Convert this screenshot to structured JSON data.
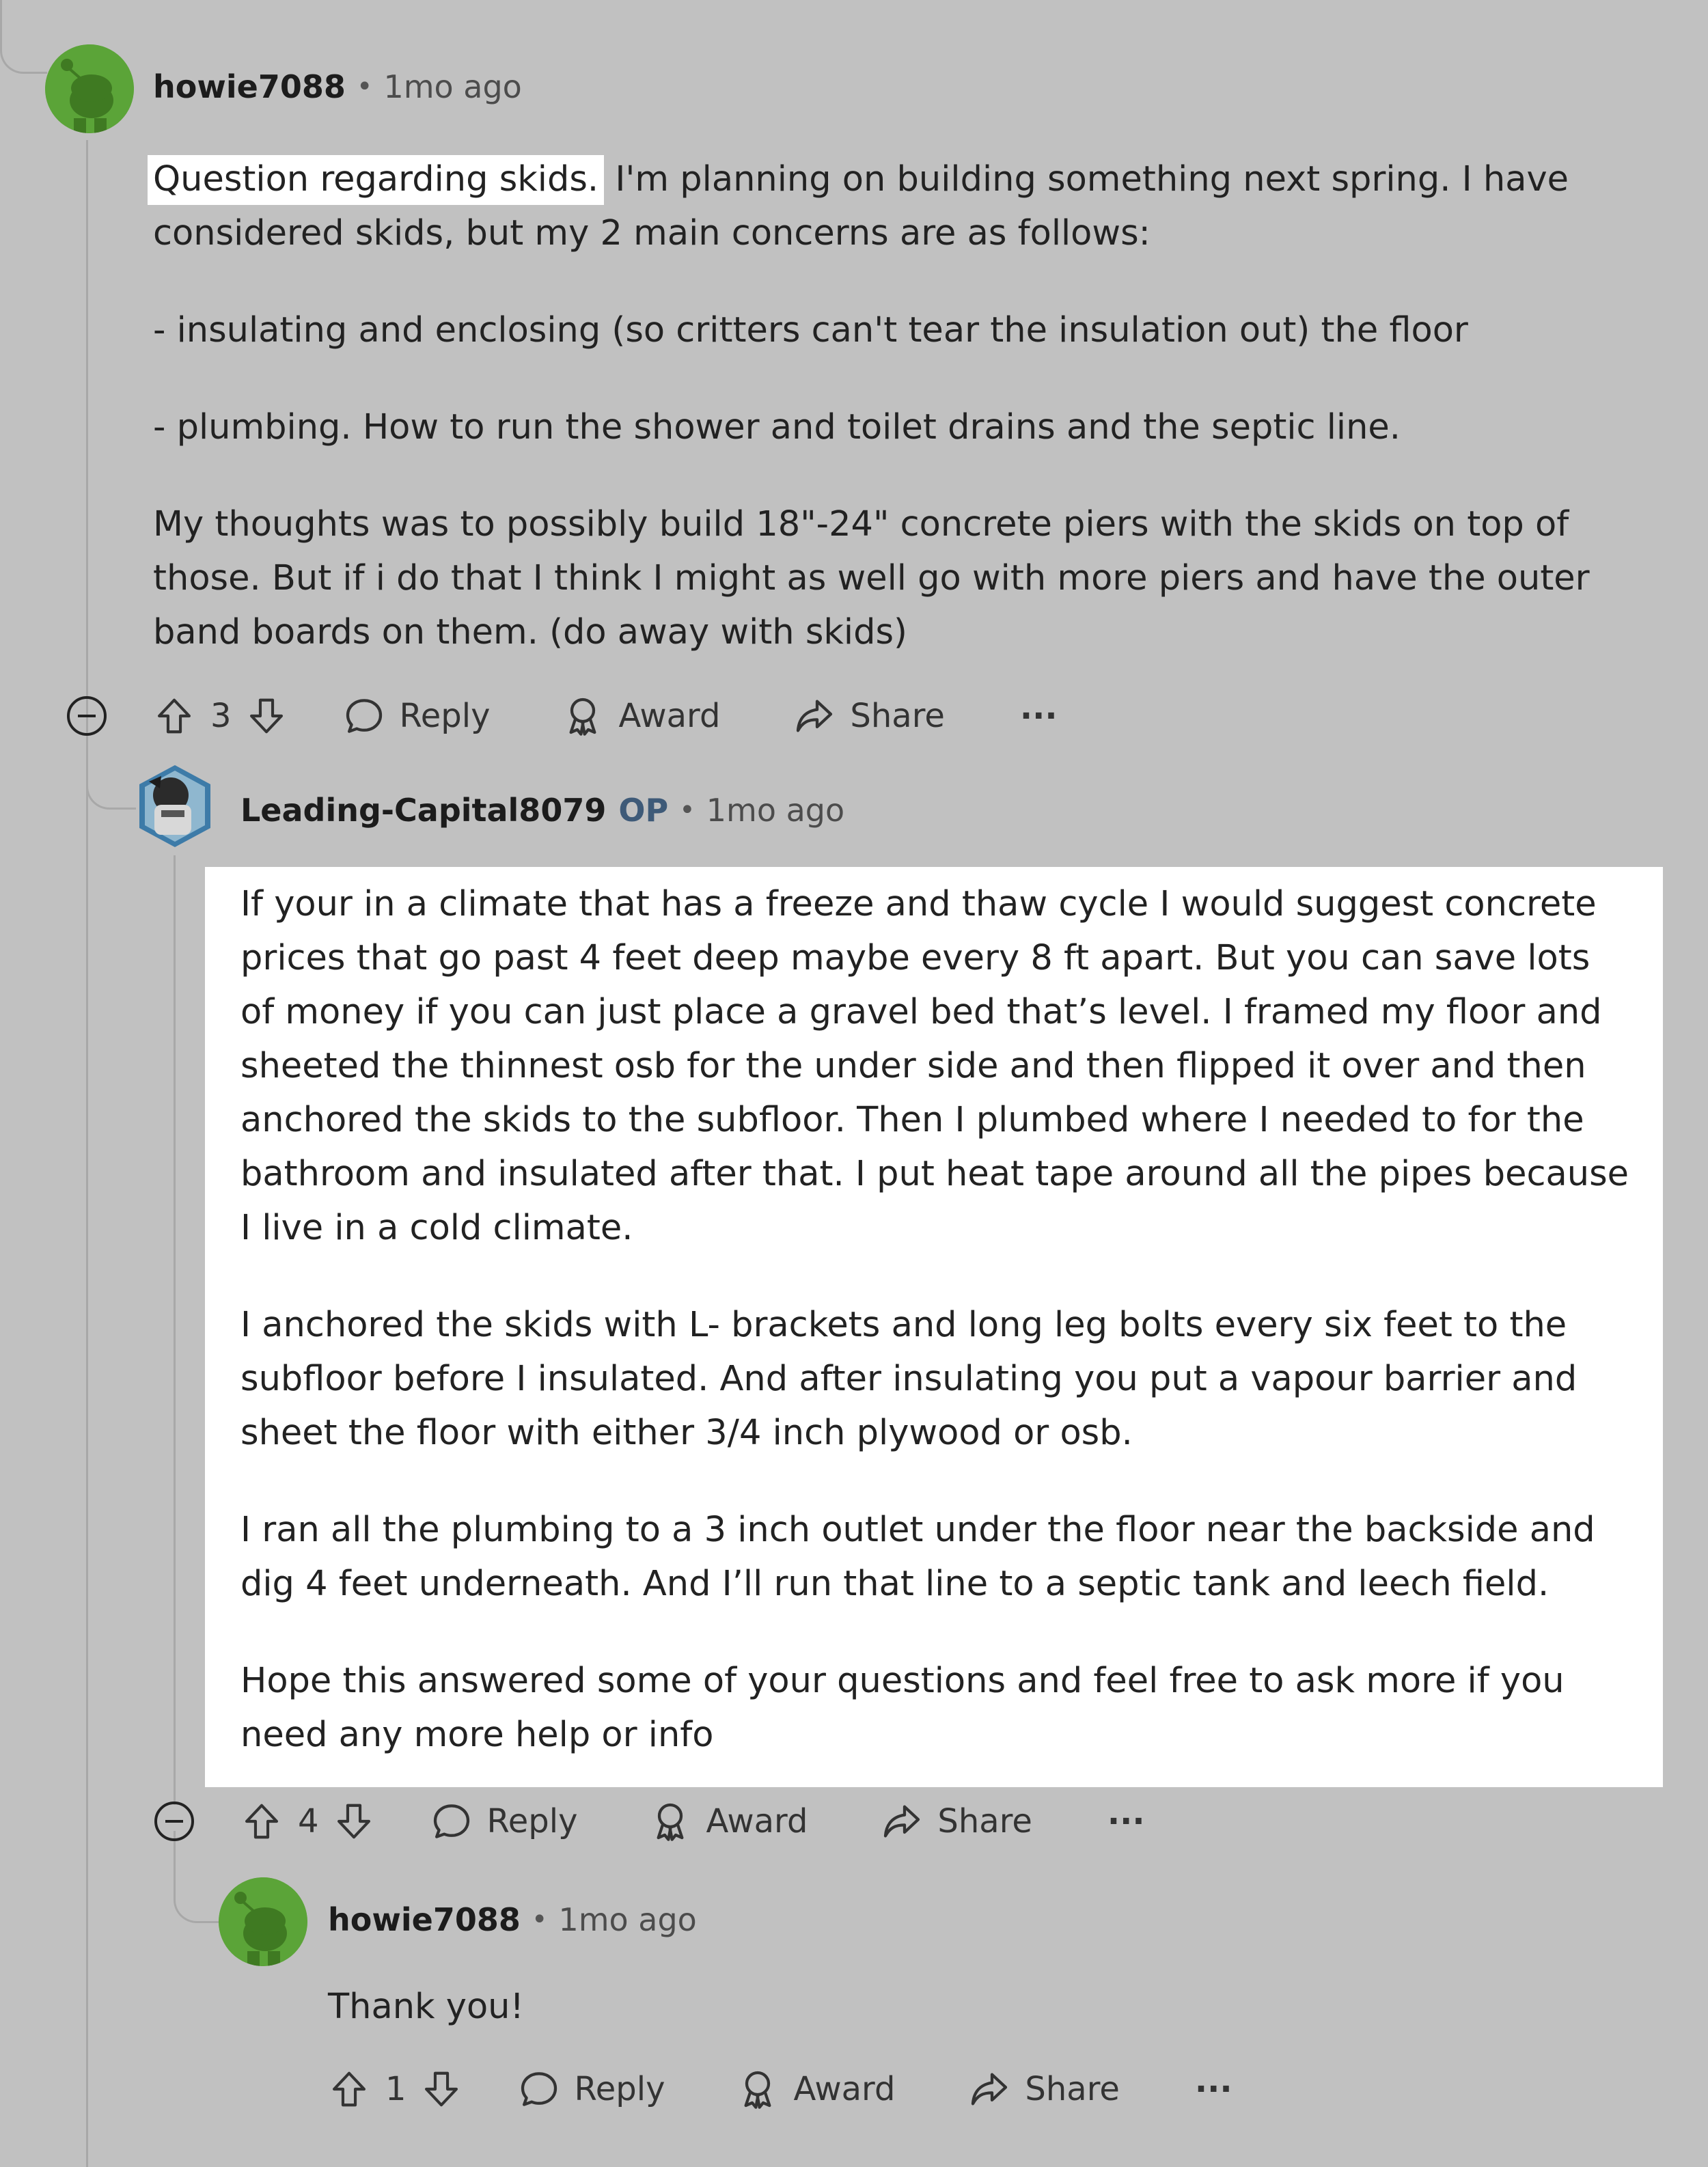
{
  "comments": [
    {
      "username": "howie7088",
      "op_badge": "",
      "time": "1mo ago",
      "highlight": "Question regarding skids.",
      "paragraphs": [
        " I'm planning on building something next spring. I have considered skids, but my 2 main concerns are as follows:",
        "- insulating and enclosing (so critters can't tear the insulation out) the floor",
        "- plumbing. How to run the shower and toilet drains and the septic line.",
        "My thoughts was to possibly build 18\"-24\" concrete piers with the skids on top of those. But if i do that I think I might as well go with more piers and have the outer band boards on them. (do away with skids)"
      ],
      "votes": "3"
    },
    {
      "username": "Leading-Capital8079",
      "op_badge": "OP",
      "time": "1mo ago",
      "paragraphs": [
        "If your in a climate that has a freeze and thaw cycle I would suggest concrete prices that go past 4 feet deep maybe every 8 ft apart. But you can save lots of money if you can just place a gravel bed that’s level. I framed my floor and sheeted the thinnest osb for the under side and then flipped it over and then anchored the skids to the subfloor. Then I plumbed where I needed to for the bathroom and insulated after that. I put heat tape around all the pipes because I live in a cold climate.",
        "I anchored the skids with L- brackets and long leg bolts every six feet to the subfloor before I insulated. And after insulating you put a vapour barrier and sheet the floor with either 3/4 inch plywood or osb.",
        "I ran all the plumbing to a 3 inch outlet under the floor near the backside and dig 4 feet underneath. And I’ll run that line to a septic tank and leech field.",
        "Hope this answered some of your questions and feel free to ask more if you need any more help or info"
      ],
      "votes": "4"
    },
    {
      "username": "howie7088",
      "op_badge": "",
      "time": "1mo ago",
      "paragraphs": [
        "Thank you!"
      ],
      "votes": "1"
    }
  ],
  "actions": {
    "reply": "Reply",
    "award": "Award",
    "share": "Share",
    "more": "···"
  },
  "icons": [
    "upvote-icon",
    "downvote-icon",
    "reply-icon",
    "award-icon",
    "share-icon",
    "more-icon",
    "collapse-icon",
    "avatar-icon"
  ],
  "colors": {
    "background": "#c1c1c1",
    "highlight": "#ffffff",
    "avatar_green": "#5ba438",
    "op_badge": "#3e5a78"
  }
}
